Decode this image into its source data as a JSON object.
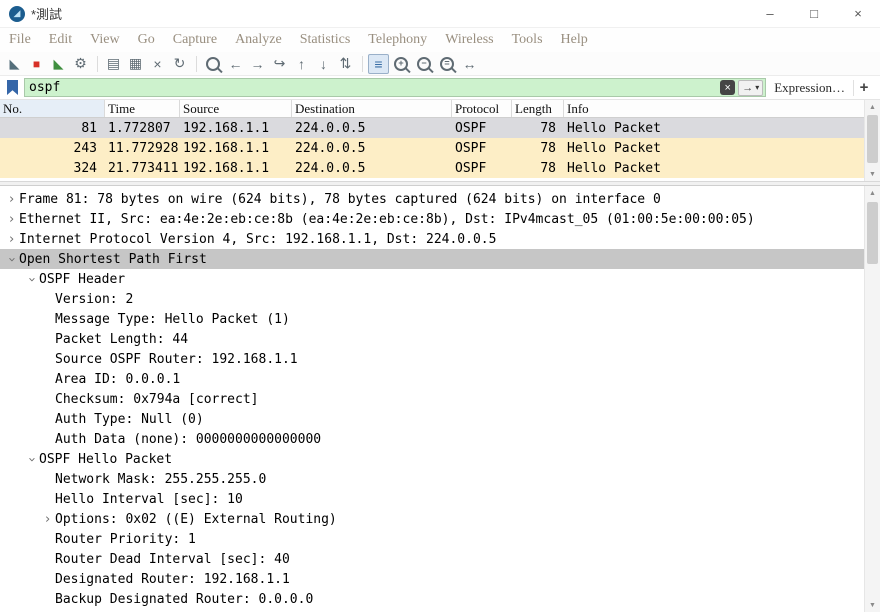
{
  "titlebar": {
    "title": "*測試",
    "minimize": "–",
    "maximize": "□",
    "close": "×"
  },
  "menu": {
    "items": [
      "File",
      "Edit",
      "View",
      "Go",
      "Capture",
      "Analyze",
      "Statistics",
      "Telephony",
      "Wireless",
      "Tools",
      "Help"
    ]
  },
  "toolbar": {
    "icons": [
      {
        "name": "start-capture",
        "glyph": "◣"
      },
      {
        "name": "stop-capture",
        "glyph": "■"
      },
      {
        "name": "restart-capture",
        "glyph": "◣"
      },
      {
        "name": "capture-options",
        "glyph": "⚙"
      },
      {
        "name": "open-capture",
        "glyph": "▤"
      },
      {
        "name": "save-capture",
        "glyph": "▦"
      },
      {
        "name": "close-capture",
        "glyph": "×"
      },
      {
        "name": "reload",
        "glyph": "↻"
      },
      {
        "name": "find-packet",
        "glyph": ""
      },
      {
        "name": "go-back",
        "glyph": "←"
      },
      {
        "name": "go-forward",
        "glyph": "→"
      },
      {
        "name": "go-to-packet",
        "glyph": "↪"
      },
      {
        "name": "go-first",
        "glyph": "↑"
      },
      {
        "name": "go-last",
        "glyph": "↓"
      },
      {
        "name": "auto-scroll",
        "glyph": "⇅"
      },
      {
        "name": "colorize",
        "glyph": "≡"
      },
      {
        "name": "zoom-in",
        "glyph": "+"
      },
      {
        "name": "zoom-out",
        "glyph": "−"
      },
      {
        "name": "zoom-normal",
        "glyph": "="
      },
      {
        "name": "resize-columns",
        "glyph": "↔"
      }
    ]
  },
  "filter": {
    "value": "ospf",
    "clear_icon": "×",
    "apply_icon": "→",
    "history_caret": "▾",
    "expression_label": "Expression…",
    "add_button": "+"
  },
  "packet_list": {
    "columns": [
      "No.",
      "Time",
      "Source",
      "Destination",
      "Protocol",
      "Length",
      "Info"
    ],
    "rows": [
      {
        "no": "81",
        "time": "1.772807",
        "source": "192.168.1.1",
        "destination": "224.0.0.5",
        "protocol": "OSPF",
        "length": "78",
        "info": "Hello Packet",
        "state": "selected"
      },
      {
        "no": "243",
        "time": "11.772928",
        "source": "192.168.1.1",
        "destination": "224.0.0.5",
        "protocol": "OSPF",
        "length": "78",
        "info": "Hello Packet",
        "state": "ospf"
      },
      {
        "no": "324",
        "time": "21.773411",
        "source": "192.168.1.1",
        "destination": "224.0.0.5",
        "protocol": "OSPF",
        "length": "78",
        "info": "Hello Packet",
        "state": "ospf"
      }
    ]
  },
  "details": {
    "lines": [
      {
        "depth": 0,
        "expander": "collapsed",
        "selected": false,
        "text": "Frame 81: 78 bytes on wire (624 bits), 78 bytes captured (624 bits) on interface 0"
      },
      {
        "depth": 0,
        "expander": "collapsed",
        "selected": false,
        "text": "Ethernet II, Src: ea:4e:2e:eb:ce:8b (ea:4e:2e:eb:ce:8b), Dst: IPv4mcast_05 (01:00:5e:00:00:05)"
      },
      {
        "depth": 0,
        "expander": "collapsed",
        "selected": false,
        "text": "Internet Protocol Version 4, Src: 192.168.1.1, Dst: 224.0.0.5"
      },
      {
        "depth": 0,
        "expander": "expanded",
        "selected": true,
        "text": "Open Shortest Path First"
      },
      {
        "depth": 1,
        "expander": "expanded",
        "selected": false,
        "text": "OSPF Header"
      },
      {
        "depth": 2,
        "expander": "none",
        "selected": false,
        "text": "Version: 2"
      },
      {
        "depth": 2,
        "expander": "none",
        "selected": false,
        "text": "Message Type: Hello Packet (1)"
      },
      {
        "depth": 2,
        "expander": "none",
        "selected": false,
        "text": "Packet Length: 44"
      },
      {
        "depth": 2,
        "expander": "none",
        "selected": false,
        "text": "Source OSPF Router: 192.168.1.1"
      },
      {
        "depth": 2,
        "expander": "none",
        "selected": false,
        "text": "Area ID: 0.0.0.1"
      },
      {
        "depth": 2,
        "expander": "none",
        "selected": false,
        "text": "Checksum: 0x794a [correct]"
      },
      {
        "depth": 2,
        "expander": "none",
        "selected": false,
        "text": "Auth Type: Null (0)"
      },
      {
        "depth": 2,
        "expander": "none",
        "selected": false,
        "text": "Auth Data (none): 0000000000000000"
      },
      {
        "depth": 1,
        "expander": "expanded",
        "selected": false,
        "text": "OSPF Hello Packet"
      },
      {
        "depth": 2,
        "expander": "none",
        "selected": false,
        "text": "Network Mask: 255.255.255.0"
      },
      {
        "depth": 2,
        "expander": "none",
        "selected": false,
        "text": "Hello Interval [sec]: 10"
      },
      {
        "depth": 2,
        "expander": "collapsed",
        "selected": false,
        "text": "Options: 0x02 ((E) External Routing)"
      },
      {
        "depth": 2,
        "expander": "none",
        "selected": false,
        "text": "Router Priority: 1"
      },
      {
        "depth": 2,
        "expander": "none",
        "selected": false,
        "text": "Router Dead Interval [sec]: 40"
      },
      {
        "depth": 2,
        "expander": "none",
        "selected": false,
        "text": "Designated Router: 192.168.1.1"
      },
      {
        "depth": 2,
        "expander": "none",
        "selected": false,
        "text": "Backup Designated Router: 0.0.0.0"
      }
    ]
  },
  "icons": {
    "expander": "›",
    "app_fin": "◢",
    "scroll_up": "▲",
    "scroll_down": "▼"
  },
  "colors": {
    "filter_valid_bg": "#cdf2cd",
    "row_selected_bg": "#dadade",
    "row_ospf_bg": "#fdeec6",
    "detail_selected_bg": "#c6c6c6",
    "accent_blue": "#3a6ea5",
    "stop_red": "#d73027",
    "restart_green": "#3f8f3f"
  }
}
